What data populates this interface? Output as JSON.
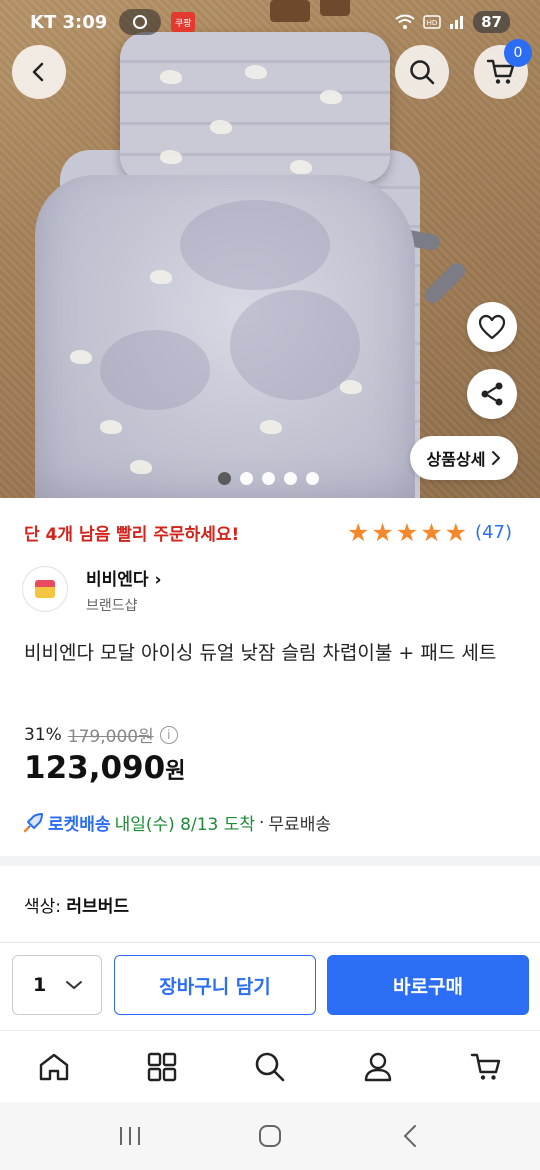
{
  "status_bar": {
    "carrier": "KT",
    "time": "3:09",
    "app_badge": "쿠팡",
    "battery": "87"
  },
  "header": {
    "cart_count": "0"
  },
  "hero": {
    "detail_button": "상품상세",
    "slide_count": 5,
    "active_slide": 1
  },
  "product": {
    "urgency": "단 4개 남음 빨리 주문하세요!",
    "rating_stars": 5,
    "review_count": "(47)",
    "brand_name": "비비엔다",
    "brand_sub": "브랜드샵",
    "title": "비비엔다 모달 아이싱 듀얼 낮잠 슬림 차렵이불 + 패드 세트",
    "discount_rate": "31%",
    "original_price": "179,000원",
    "price_number": "123,090",
    "price_unit": "원",
    "delivery_type": "로켓배송",
    "delivery_date": "내일(수) 8/13 도착",
    "delivery_separator": "·",
    "delivery_fee": "무료배송",
    "option_label": "색상:",
    "option_value": "러브버드"
  },
  "action_bar": {
    "quantity": "1",
    "add_to_cart": "장바구니 담기",
    "buy_now": "바로구매"
  },
  "colors": {
    "accent": "#2b6ef5",
    "urgency": "#d3241b",
    "star": "#f4882a",
    "delivery_green": "#1d8a35"
  },
  "bottom_nav": [
    "home-icon",
    "category-icon",
    "search-icon",
    "my-page-icon",
    "cart-icon"
  ]
}
